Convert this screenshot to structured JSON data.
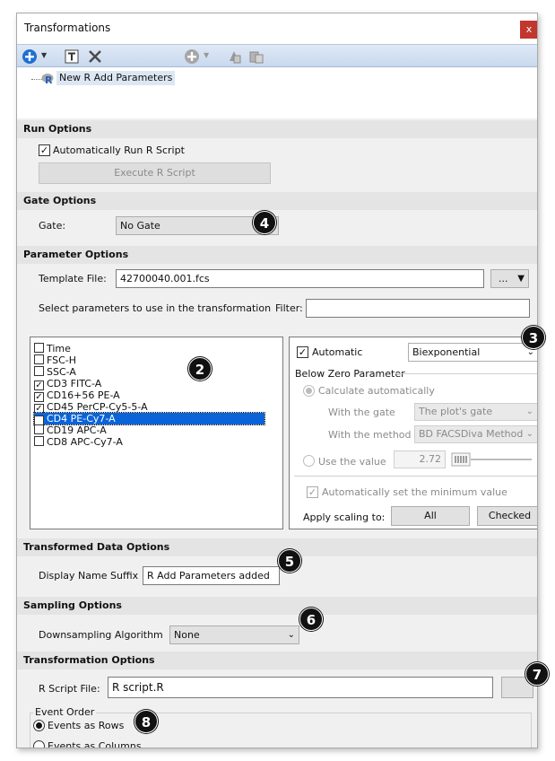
{
  "window": {
    "title": "Transformations",
    "close_glyph": "x"
  },
  "toolbar": {
    "icons": [
      "add-icon",
      "text-icon",
      "delete-icon",
      "add-disabled-icon",
      "copy-icon",
      "paste-icon"
    ]
  },
  "tree": {
    "item_label": "New R Add Parameters"
  },
  "run_options": {
    "header": "Run Options",
    "auto_run_label": "Automatically Run R Script",
    "auto_run_checked": true,
    "execute_label": "Execute R Script"
  },
  "gate_options": {
    "header": "Gate Options",
    "gate_label": "Gate:",
    "gate_value": "No Gate"
  },
  "parameter_options": {
    "header": "Parameter Options",
    "template_label": "Template File:",
    "template_value": "42700040.001.fcs",
    "browse_label": "...",
    "select_label": "Select parameters to use in the transformation",
    "filter_label": "Filter:",
    "filter_value": "",
    "parameters": [
      {
        "name": "Time",
        "checked": false,
        "selected": false
      },
      {
        "name": "FSC-H",
        "checked": false,
        "selected": false
      },
      {
        "name": "SSC-A",
        "checked": false,
        "selected": false
      },
      {
        "name": "CD3 FITC-A",
        "checked": true,
        "selected": false
      },
      {
        "name": "CD16+56 PE-A",
        "checked": true,
        "selected": false
      },
      {
        "name": "CD45 PerCP-Cy5-5-A",
        "checked": true,
        "selected": false
      },
      {
        "name": "CD4 PE-Cy7-A",
        "checked": true,
        "selected": true
      },
      {
        "name": "CD19 APC-A",
        "checked": false,
        "selected": false
      },
      {
        "name": "CD8 APC-Cy7-A",
        "checked": false,
        "selected": false
      }
    ]
  },
  "scaling": {
    "automatic_label": "Automatic",
    "automatic_checked": true,
    "scale_value": "Biexponential",
    "below_zero_header": "Below Zero Parameter",
    "calc_auto_label": "Calculate automatically",
    "with_gate_label": "With the gate",
    "gate_value": "The plot's gate",
    "with_method_label": "With the method",
    "method_value": "BD FACSDiva Method",
    "use_value_label": "Use the value",
    "value": "2.72",
    "auto_min_label": "Automatically set the minimum value",
    "apply_label": "Apply scaling to:",
    "all_label": "All",
    "checked_label": "Checked"
  },
  "transformed_data": {
    "header": "Transformed Data Options",
    "suffix_label": "Display Name Suffix",
    "suffix_value": "R Add Parameters added"
  },
  "sampling": {
    "header": "Sampling Options",
    "algorithm_label": "Downsampling Algorithm",
    "algorithm_value": "None"
  },
  "transformation": {
    "header": "Transformation Options",
    "script_label": "R Script File:",
    "script_value": "R script.R",
    "event_order_label": "Event Order",
    "rows_label": "Events as Rows",
    "columns_label": "Events as Columns",
    "rows_selected": true
  },
  "callouts": [
    "2",
    "3",
    "4",
    "5",
    "6",
    "7",
    "8"
  ]
}
